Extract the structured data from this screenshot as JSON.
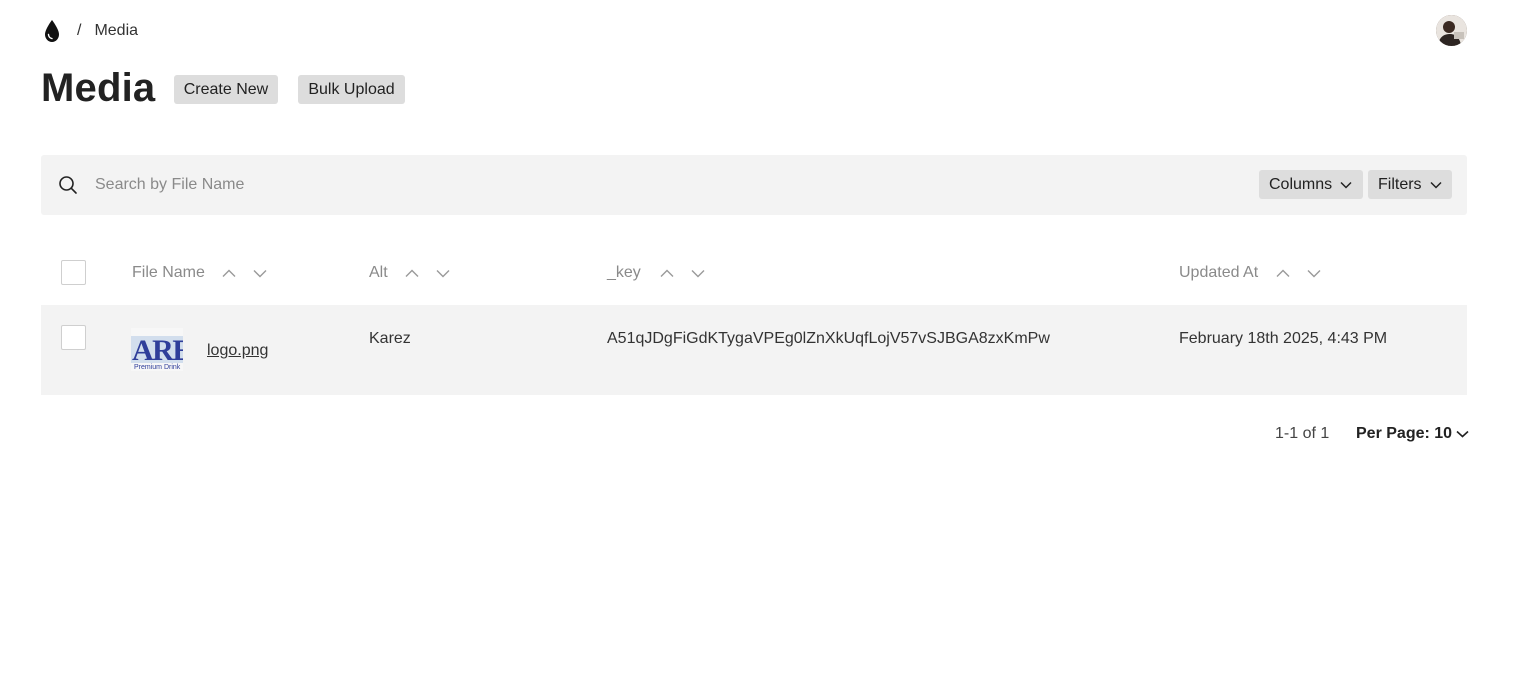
{
  "breadcrumb": {
    "logo_icon": "drop-icon",
    "separator": "/",
    "current": "Media"
  },
  "header": {
    "title": "Media",
    "create_label": "Create New",
    "bulk_label": "Bulk Upload"
  },
  "search": {
    "placeholder": "Search by File Name",
    "value": "",
    "icon": "search-icon",
    "columns_label": "Columns",
    "filters_label": "Filters"
  },
  "table": {
    "columns": [
      "File Name",
      "Alt",
      "_key",
      "Updated At"
    ],
    "rows": [
      {
        "thumbnail_text": "ARE",
        "thumbnail_subtext": "Premium Drink",
        "file_name": "logo.png",
        "alt": "Karez",
        "key": "A51qJDgFiGdKTygaVPEg0lZnXkUqfLojV57vSJBGA8zxKmPw",
        "updated_at": "February 18th 2025, 4:43 PM"
      }
    ]
  },
  "pagination": {
    "range": "1-1 of 1",
    "per_page_label": "Per Page: 10"
  },
  "colors": {
    "panel_bg": "#f3f3f3",
    "button_bg": "#dddddd",
    "text": "#222222",
    "muted_text": "#8a8a8a"
  }
}
